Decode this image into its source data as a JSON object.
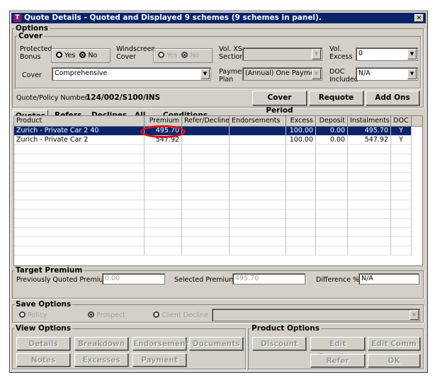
{
  "window": {
    "title": "Quote Details - Quoted and Displayed 9 schemes (9 schemes in panel).",
    "icon": "T",
    "close": "✕"
  },
  "options": {
    "legend": "Options",
    "cover_legend": "Cover",
    "protected_bonus": {
      "label1": "Protected",
      "label2": "Bonus",
      "yes": "Yes",
      "no": "No",
      "selected": "No"
    },
    "windscreen": {
      "label1": "Windscreen",
      "label2": "Cover",
      "yes": "Yes",
      "no": "No",
      "selected": "No",
      "disabled": true
    },
    "vol_xs_section": {
      "label1": "Vol. XS",
      "label2": "Section",
      "value": ""
    },
    "vol_excess": {
      "label1": "Vol.",
      "label2": "Excess",
      "value": "0"
    },
    "cover": {
      "label": "Cover",
      "value": "Comprehensive"
    },
    "payment_plan": {
      "label1": "Payment",
      "label2": "Plan",
      "value": "(Annual) One Payment Ir"
    },
    "doc_included": {
      "label1": "DOC",
      "label2": "Included",
      "value": "N/A"
    },
    "quote_number_label": "Quote/Policy Number",
    "quote_number": "124/002/S100/INS",
    "buttons": [
      "Cover Period",
      "Requote",
      "Add Ons"
    ]
  },
  "tabs": [
    {
      "label": "Quotes",
      "active": true
    },
    {
      "label": "Refers"
    },
    {
      "label": "Declines"
    },
    {
      "label": "All"
    },
    {
      "label": "Conditions"
    }
  ],
  "grid": {
    "columns": [
      "Product",
      "Premium",
      "Refer/Decline",
      "Endorsements",
      "Excess",
      "Deposit",
      "Instalments",
      "DOC"
    ],
    "rows": [
      [
        "Zurich - Private Car 2 40",
        "495.70",
        "",
        "",
        "100.00",
        "0.00",
        "495.70",
        "Y"
      ],
      [
        "Zurich - Private Car 2",
        "547.92",
        "",
        "",
        "100.00",
        "0.00",
        "547.92",
        "Y"
      ]
    ],
    "selected_row": 0,
    "highlight_color": "#e0101a"
  },
  "target_premium": {
    "legend": "Target Premium",
    "prev_label": "Previously Quoted Premium",
    "prev_value": "0.00",
    "sel_label": "Selected Premium",
    "sel_value": "495.70",
    "diff_label": "Difference %",
    "diff_value": "N/A"
  },
  "save_options": {
    "legend": "Save Options",
    "options": [
      "Policy",
      "Prospect",
      "Client Decline"
    ],
    "selected": "Prospect"
  },
  "view_options": {
    "legend": "View Options",
    "buttons": [
      "Details",
      "Breakdown",
      "Endorsements",
      "Documents",
      "Notes",
      "Excesses",
      "Payment"
    ]
  },
  "product_options": {
    "legend": "Product Options",
    "buttons": [
      "Discount",
      "Edit Premium",
      "Edit Comm",
      "Refer",
      "OK"
    ]
  }
}
